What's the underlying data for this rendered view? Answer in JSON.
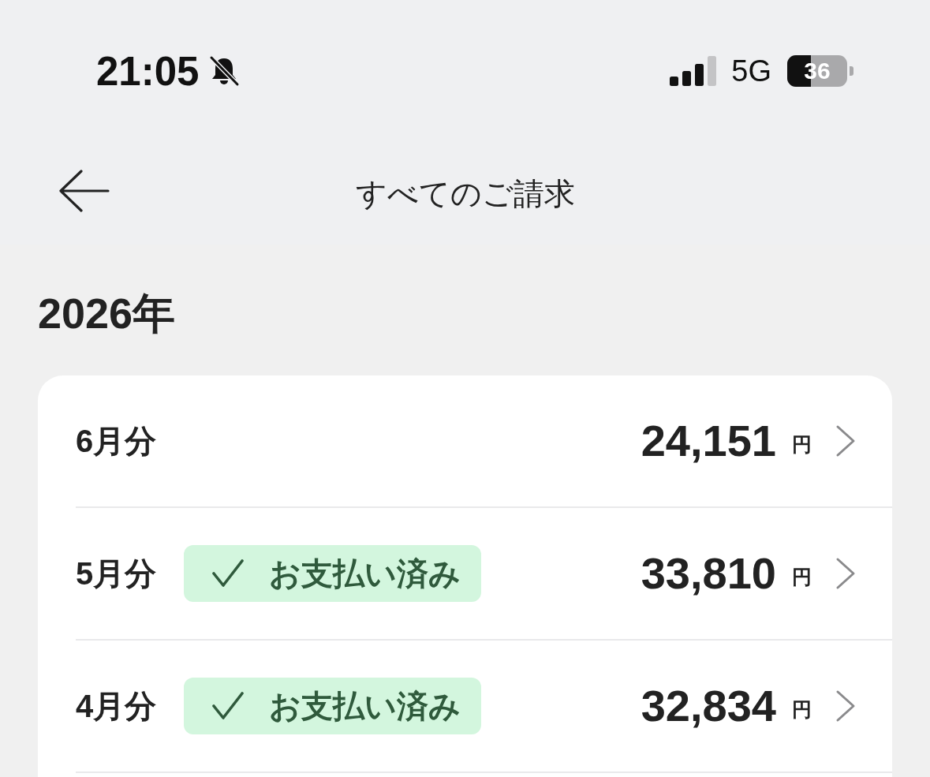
{
  "status_bar": {
    "time": "21:05",
    "network": "5G",
    "battery": "36"
  },
  "header": {
    "title": "すべてのご請求"
  },
  "sections": [
    {
      "year": "2026年",
      "bills": [
        {
          "month": "6月分",
          "paid": false,
          "amount": "24,151",
          "currency": "円"
        },
        {
          "month": "5月分",
          "paid": true,
          "badge": "お支払い済み",
          "amount": "33,810",
          "currency": "円"
        },
        {
          "month": "4月分",
          "paid": true,
          "badge": "お支払い済み",
          "amount": "32,834",
          "currency": "円"
        }
      ]
    }
  ]
}
